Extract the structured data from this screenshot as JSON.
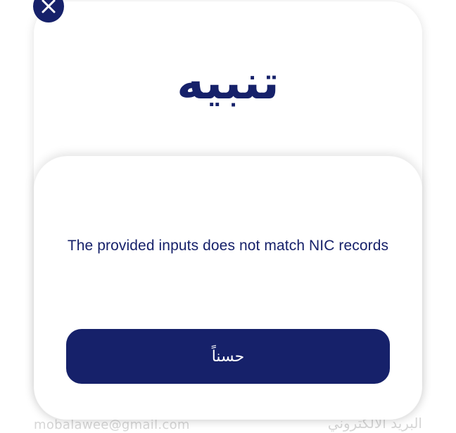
{
  "background": {
    "email_hint": "mobalawee@gmail.com",
    "email_label": "البريد الالكتروني"
  },
  "dialog": {
    "title": "تنبيه",
    "message": "The provided inputs does not match NIC records",
    "ok_label": "حسناً",
    "close_icon": "close-icon"
  },
  "colors": {
    "primary": "#16216a",
    "surface": "#ffffff",
    "faded_text": "#d6d6d6"
  }
}
